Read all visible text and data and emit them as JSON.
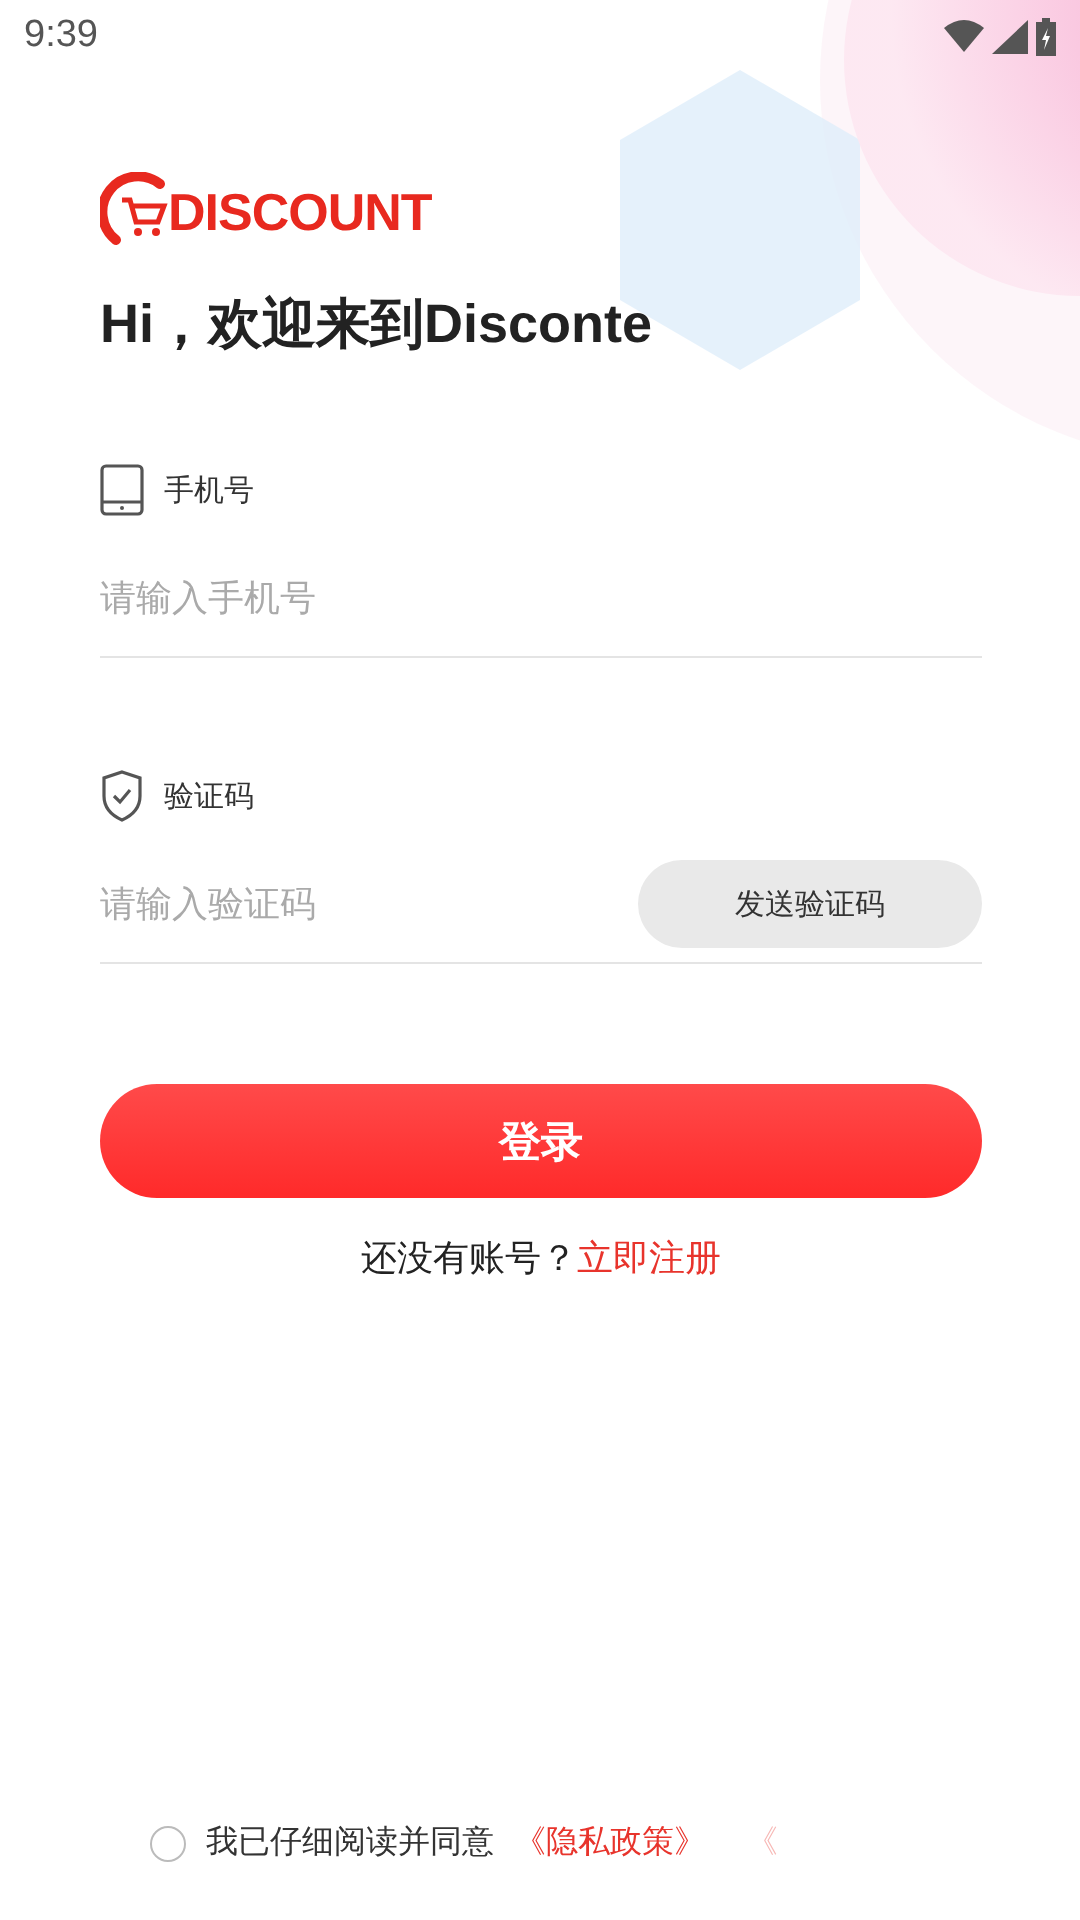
{
  "status_bar": {
    "time": "9:39"
  },
  "logo": {
    "text": "DISCOUNT"
  },
  "greeting": "Hi，欢迎来到Disconte",
  "phone": {
    "label": "手机号",
    "placeholder": "请输入手机号"
  },
  "code": {
    "label": "验证码",
    "placeholder": "请输入验证码",
    "send_button": "发送验证码"
  },
  "login_button": "登录",
  "register": {
    "prompt": "还没有账号？",
    "link": "立即注册"
  },
  "agreement": {
    "checked": false,
    "text": "我已仔细阅读并同意",
    "link": "《隐私政策》",
    "trailing": "《"
  }
}
